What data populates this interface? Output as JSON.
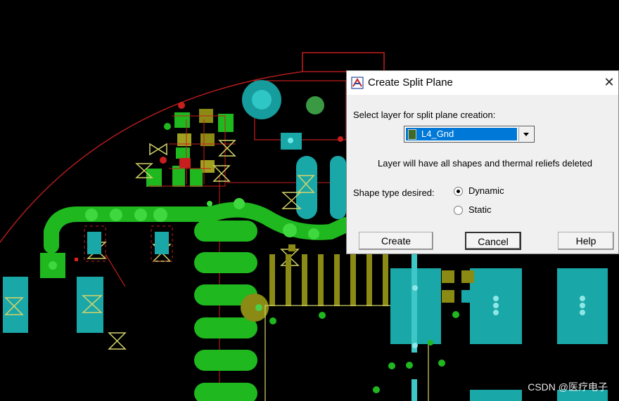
{
  "dialog": {
    "title": "Create Split Plane",
    "select_label": "Select layer for split plane creation:",
    "layer_value": "L4_Gnd",
    "layer_swatch_color": "#3d6b2a",
    "warning": "Layer will have all shapes and thermal reliefs deleted",
    "shape_label": "Shape type desired:",
    "options": [
      {
        "label": "Dynamic",
        "selected": true
      },
      {
        "label": "Static",
        "selected": false
      }
    ],
    "buttons": {
      "create": "Create",
      "cancel": "Cancel",
      "help": "Help"
    },
    "icons": {
      "app": "split-plane-app-icon",
      "close": "close-icon",
      "dropdown": "chevron-down-icon"
    }
  },
  "watermark": "CSDN @医疗电子",
  "colors": {
    "background": "#000000",
    "trace": "#1fb81f",
    "pad_cyan": "#19a7a7",
    "via_olive": "#8a8a15",
    "outline_red": "#c81e1e",
    "outline_yellow": "#d4d46a"
  }
}
